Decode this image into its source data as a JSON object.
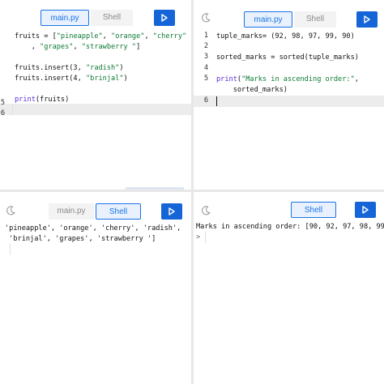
{
  "panels": {
    "top_left": {
      "tabs": {
        "file": "main.py",
        "shell": "Shell"
      },
      "line_numbers": [
        "",
        "",
        "",
        "",
        "",
        "5",
        "6"
      ],
      "code": {
        "l1_var": "fruits = [",
        "l1_s1": "\"pineapple\"",
        "l1_c1": ", ",
        "l1_s2": "\"orange\"",
        "l1_c2": ", ",
        "l1_s3": "\"cherry\"",
        "l2_pre": "    , ",
        "l2_s1": "\"grapes\"",
        "l2_c1": ", ",
        "l2_s2": "\"strawberry \"",
        "l2_end": "]",
        "l3_pre": "fruits.insert(3, ",
        "l3_s": "\"radish\"",
        "l3_end": ")",
        "l4_pre": "fruits.insert(4, ",
        "l4_s": "\"brinjal\"",
        "l4_end": ")",
        "l5_kw": "print",
        "l5_rest": "(fruits)"
      }
    },
    "top_right": {
      "tabs": {
        "file": "main.py",
        "shell": "Shell"
      },
      "line_numbers": [
        "1",
        "2",
        "3",
        "4",
        "5",
        "",
        "6"
      ],
      "code": {
        "l1": "tuple_marks= (92, 98, 97, 99, 90)",
        "l3": "sorted_marks = sorted(tuple_marks)",
        "l5_kw": "print",
        "l5_open": "(",
        "l5_s": "\"Marks in ascending order:\"",
        "l5_c": ",",
        "l6": "    sorted_marks)"
      }
    },
    "bottom_left": {
      "tabs": {
        "file": "main.py",
        "shell": "Shell"
      },
      "output": [
        "'pineapple', 'orange', 'cherry', 'radish',",
        " 'brinjal', 'grapes', 'strawberry ']"
      ]
    },
    "bottom_right": {
      "tabs": {
        "shell": "Shell"
      },
      "output": [
        "Marks in ascending order: [90, 92, 97, 98, 99"
      ],
      "prompt": ">"
    }
  },
  "colors": {
    "accent": "#1a73e8",
    "run_button": "#1565d8",
    "string": "#0d7a33",
    "keyword": "#5b2bd6"
  },
  "icons": [
    "moon-icon",
    "play-icon"
  ]
}
